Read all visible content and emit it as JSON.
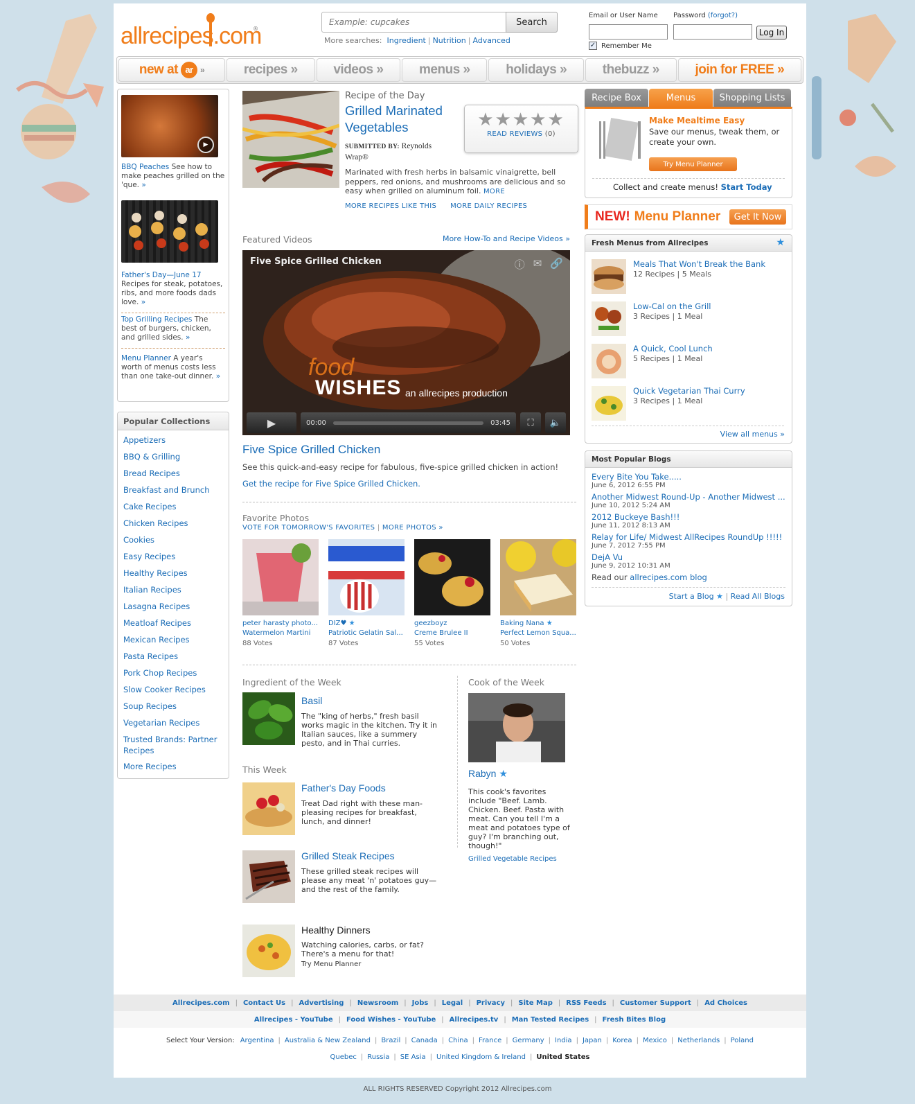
{
  "header": {
    "logo": "allrecipes.com",
    "search_placeholder": "Example: cupcakes",
    "search_button": "Search",
    "more_searches_label": "More searches:",
    "more_searches": [
      "Ingredient",
      "Nutrition",
      "Advanced"
    ],
    "login": {
      "email_label": "Email or User Name",
      "password_label": "Password",
      "forgot": "(forgot?)",
      "button": "Log In",
      "remember": "Remember Me"
    }
  },
  "nav": [
    {
      "label": "new at"
    },
    {
      "label": "recipes »"
    },
    {
      "label": "videos »"
    },
    {
      "label": "menus »"
    },
    {
      "label": "holidays »"
    },
    {
      "label": "thebuzz »"
    },
    {
      "label": "join for FREE »"
    }
  ],
  "left": {
    "promos": [
      {
        "title": "BBQ Peaches",
        "text": " See how to make peaches grilled on the 'que.",
        "arrow": "»"
      },
      {
        "title": "Father's Day—June 17",
        "text": "Recipes for steak, potatoes, ribs, and more foods dads love.",
        "arrow": "»"
      },
      {
        "title": "Top Grilling Recipes",
        "text": " The best of burgers, chicken, and grilled sides.",
        "arrow": "»"
      },
      {
        "title": "Menu Planner",
        "text": " A year's worth of menus costs less than one take-out dinner.",
        "arrow": "»"
      }
    ],
    "collections_title": "Popular Collections",
    "collections": [
      "Appetizers",
      "BBQ & Grilling",
      "Bread Recipes",
      "Breakfast and Brunch",
      "Cake Recipes",
      "Chicken Recipes",
      "Cookies",
      "Easy Recipes",
      "Healthy Recipes",
      "Italian Recipes",
      "Lasagna Recipes",
      "Meatloaf Recipes",
      "Mexican Recipes",
      "Pasta Recipes",
      "Pork Chop Recipes",
      "Slow Cooker Recipes",
      "Soup Recipes",
      "Vegetarian Recipes",
      "Trusted Brands: Partner Recipes",
      "More Recipes"
    ]
  },
  "rod": {
    "label": "Recipe of the Day",
    "title": "Grilled Marinated Vegetables",
    "submitted_label": "SUBMITTED BY:",
    "submitted_by": "Reynolds Wrap®",
    "stars": "★★★★★",
    "reviews": "READ REVIEWS",
    "reviews_count": "(0)",
    "desc": "Marinated with fresh herbs in balsamic vinaigrette, bell peppers, red onions, and mushrooms are delicious and so easy when grilled on aluminum foil.",
    "more": "MORE",
    "link1": "MORE RECIPES LIKE THIS",
    "link2": "MORE DAILY RECIPES"
  },
  "videos": {
    "label": "Featured Videos",
    "more": "More How-To and Recipe Videos »",
    "player_title": "Five Spice Grilled Chicken",
    "brand_food": "food",
    "brand_wishes": "WISHES",
    "brand_prod": "an allrecipes production",
    "time_start": "00:00",
    "time_end": "03:45",
    "title": "Five Spice Grilled Chicken",
    "desc": "See this quick-and-easy recipe for fabulous, five-spice grilled chicken in action!",
    "link": "Get the recipe for Five Spice Grilled Chicken."
  },
  "photos": {
    "label": "Favorite Photos",
    "vote_link": "VOTE FOR TOMORROW'S FAVORITES",
    "more_link": "MORE PHOTOS »",
    "items": [
      {
        "who": "peter harasty photo...",
        "what": "Watermelon Martini",
        "votes": "88 Votes"
      },
      {
        "who": "DIZ♥",
        "what": "Patriotic Gelatin Sal...",
        "votes": "87 Votes"
      },
      {
        "who": "geezboyz",
        "what": "Creme Brulee II",
        "votes": "55 Votes"
      },
      {
        "who": "Baking Nana",
        "what": "Perfect Lemon Squa...",
        "votes": "50 Votes"
      }
    ]
  },
  "iotw": {
    "label": "Ingredient of the Week",
    "title": "Basil",
    "desc": "The \"king of herbs,\" fresh basil works magic in the kitchen. Try it in Italian sauces, like a summery pesto, and in Thai curries."
  },
  "this_week": {
    "label": "This Week",
    "items": [
      {
        "title": "Father's Day Foods",
        "desc": "Treat Dad right with these man-pleasing recipes for breakfast, lunch, and dinner!"
      },
      {
        "title": "Grilled Steak Recipes",
        "desc": "These grilled steak recipes will please any meat 'n' potatoes guy—and the rest of the family."
      },
      {
        "title": "Healthy Dinners",
        "desc": "Watching calories, carbs, or fat? There's a menu for that!",
        "link": "Try Menu Planner"
      }
    ]
  },
  "cotw": {
    "label": "Cook of the Week",
    "name": "Rabyn",
    "desc": "This cook's favorites include \"Beef. Lamb. Chicken. Beef. Pasta with meat. Can you tell I'm a meat and potatoes type of guy? I'm branching out, though!\"",
    "link": "Grilled Vegetable Recipes"
  },
  "right": {
    "tabs": [
      "Recipe Box",
      "Menus",
      "Shopping Lists"
    ],
    "mm_title": "Make Mealtime Easy",
    "mm_desc": "Save our menus, tweak them, or create your own.",
    "mm_btn": "Try Menu Planner",
    "mm_collect": "Collect and create menus!",
    "mm_start": "Start Today",
    "new_mp_new": "NEW!",
    "new_mp_name": "Menu Planner",
    "new_mp_btn": "Get It Now",
    "fresh_title": "Fresh Menus from Allrecipes",
    "fresh": [
      {
        "title": "Meals That Won't Break the Bank",
        "sub": "12 Recipes | 5 Meals"
      },
      {
        "title": "Low-Cal on the Grill",
        "sub": "3 Recipes | 1 Meal"
      },
      {
        "title": "A Quick, Cool Lunch",
        "sub": "5 Recipes | 1 Meal"
      },
      {
        "title": "Quick Vegetarian Thai Curry",
        "sub": "3 Recipes | 1 Meal"
      }
    ],
    "view_all": "View all menus »",
    "blogs_title": "Most Popular Blogs",
    "blogs": [
      {
        "title": "Every Bite You Take.....",
        "date": "June 6, 2012 6:55 PM"
      },
      {
        "title": "Another Midwest Round-Up - Another Midwest ...",
        "date": "June 10, 2012 5:24 AM"
      },
      {
        "title": "2012 Buckeye Bash!!!",
        "date": "June 11, 2012 8:13 AM"
      },
      {
        "title": "Relay for Life/ Midwest AllRecipes RoundUp !!!!!",
        "date": "June 7, 2012 7:55 PM"
      },
      {
        "title": "DejA Vu",
        "date": "June 9, 2012 10:31 AM"
      }
    ],
    "read_our": "Read our",
    "blog_link": "allrecipes.com blog",
    "start_blog": "Start a Blog",
    "read_all": "Read All Blogs"
  },
  "footer": {
    "row1": [
      "Allrecipes.com",
      "Contact Us",
      "Advertising",
      "Newsroom",
      "Jobs",
      "Legal",
      "Privacy",
      "Site Map",
      "RSS Feeds",
      "Customer Support",
      "Ad Choices"
    ],
    "row2": [
      "Allrecipes - YouTube",
      "Food Wishes - YouTube",
      "Allrecipes.tv",
      "Man Tested Recipes",
      "Fresh Bites Blog"
    ],
    "version_label": "Select Your Version:",
    "versions1": [
      "Argentina",
      "Australia & New Zealand",
      "Brazil",
      "Canada",
      "China",
      "France",
      "Germany",
      "India",
      "Japan",
      "Korea",
      "Mexico",
      "Netherlands",
      "Poland"
    ],
    "versions2": [
      "Quebec",
      "Russia",
      "SE Asia",
      "United Kingdom & Ireland"
    ],
    "current": "United States",
    "copyright": "ALL RIGHTS RESERVED Copyright 2012 Allrecipes.com"
  },
  "colors": {
    "accent": "#f07d1a",
    "link": "#1a6cb6",
    "background": "#cfe0ea"
  }
}
